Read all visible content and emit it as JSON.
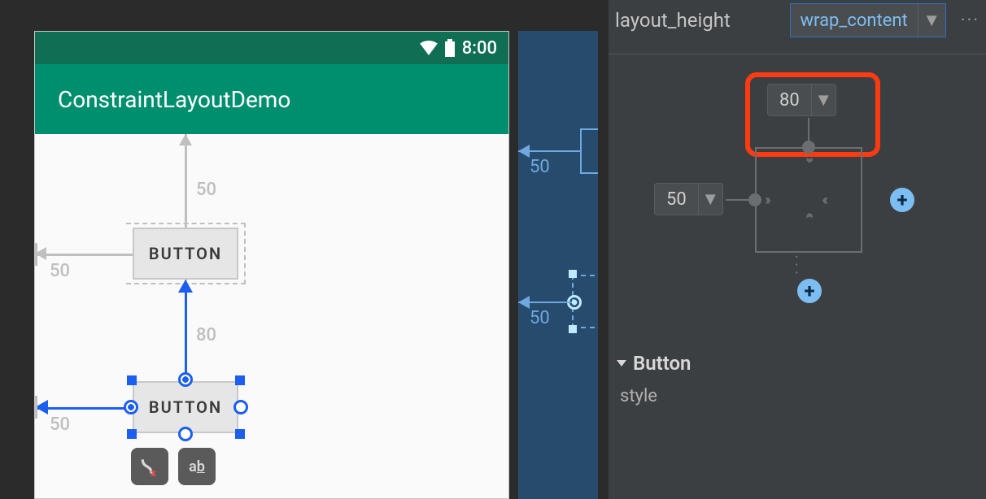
{
  "statusbar": {
    "time": "8:00"
  },
  "appbar": {
    "title": "ConstraintLayoutDemo"
  },
  "canvas": {
    "button1_text": "BUTTON",
    "button2_text": "BUTTON",
    "margin_top_1": "50",
    "margin_left_1": "50",
    "margin_between": "80",
    "margin_left_2": "50"
  },
  "blueprint": {
    "margin_left_1": "50",
    "margin_left_2": "50"
  },
  "attributes": {
    "layout_height_label": "layout_height",
    "layout_height_value": "wrap_content",
    "margin_top": "80",
    "margin_left": "50",
    "section_button": "Button",
    "prop_style": "style"
  }
}
